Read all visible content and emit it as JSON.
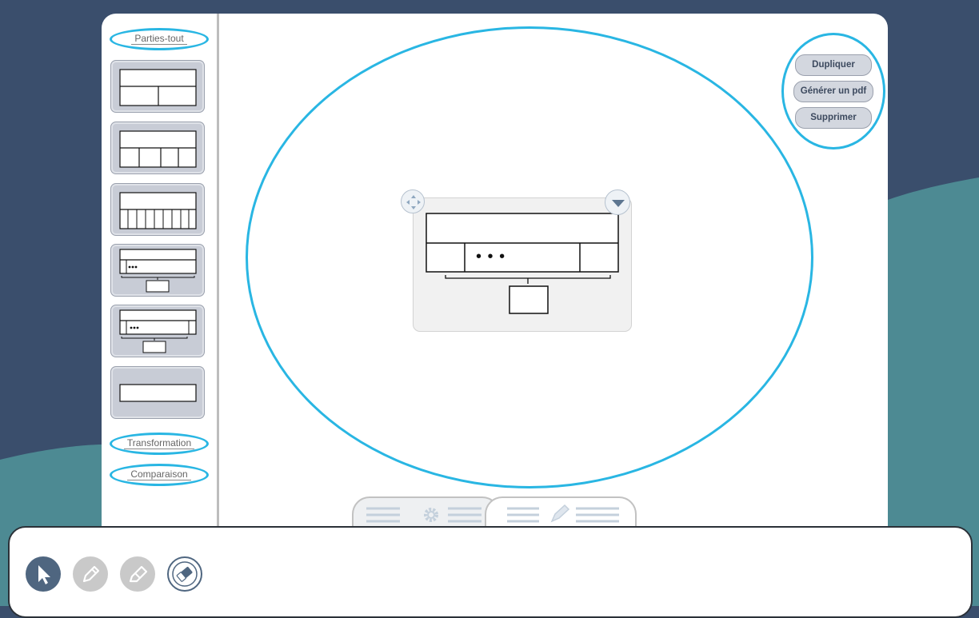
{
  "colors": {
    "background_dark": "#3a4e6c",
    "background_teal": "#4d8a93",
    "highlight_ring": "#29b6e3",
    "button_fill": "#d3d7df",
    "tool_active": "#4f6680",
    "tool_disabled": "#c9c9c9"
  },
  "sidebar": {
    "sections": {
      "parties_tout": "Parties-tout",
      "transformation": "Transformation",
      "comparaison": "Comparaison"
    },
    "templates": [
      {
        "name": "two-parts"
      },
      {
        "name": "four-parts"
      },
      {
        "name": "many-parts"
      },
      {
        "name": "unknown-parts-with-total"
      },
      {
        "name": "unknown-parts-with-total-variant"
      },
      {
        "name": "single-bar"
      }
    ]
  },
  "actions": {
    "duplicate": "Dupliquer",
    "generate_pdf": "Générer un pdf",
    "delete": "Supprimer"
  },
  "diagram": {
    "placeholder": "• • •"
  },
  "bottom_tabs": [
    {
      "icon": "gear-icon"
    },
    {
      "icon": "pencil-icon"
    }
  ],
  "tools": [
    {
      "icon": "cursor-icon",
      "state": "active"
    },
    {
      "icon": "pencil-icon",
      "state": "disabled"
    },
    {
      "icon": "marker-icon",
      "state": "disabled"
    },
    {
      "icon": "eraser-icon",
      "state": "enabled"
    }
  ]
}
